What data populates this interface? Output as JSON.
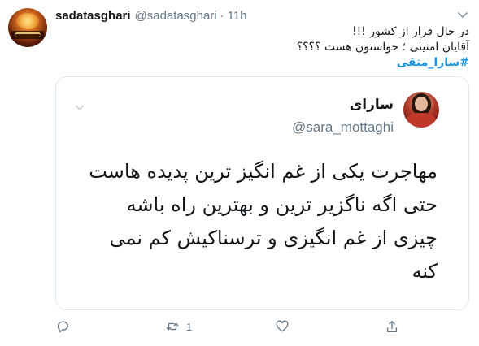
{
  "tweet": {
    "display_name": "sadatasghari",
    "handle": "@sadatasghari",
    "separator": "·",
    "time": "11h",
    "lines": [
      "در حال فرار از کشور !!!",
      "آقایان امنیتی ؛ حواستون هست ؟؟؟؟"
    ],
    "hashtag": "#سارا_متقی"
  },
  "quoted": {
    "name": "سارای",
    "handle": "@sara_mottaghi",
    "lines": [
      "مهاجرت یکی از غم انگیز ترین پدیده هاست",
      "حتی اگه ناگزیر ترین و بهترین راه باشه",
      "چیزی از غم انگیزی و ترسناکیش کم نمی",
      "کنه"
    ]
  },
  "actions": {
    "reply_icon": "comment-icon",
    "retweet_icon": "retweet-icon",
    "retweet_count": "1",
    "like_icon": "heart-icon",
    "share_icon": "share-icon"
  },
  "colors": {
    "link": "#1b95e0",
    "muted": "#657786",
    "border": "#e1e8ed",
    "text": "#14171a"
  }
}
